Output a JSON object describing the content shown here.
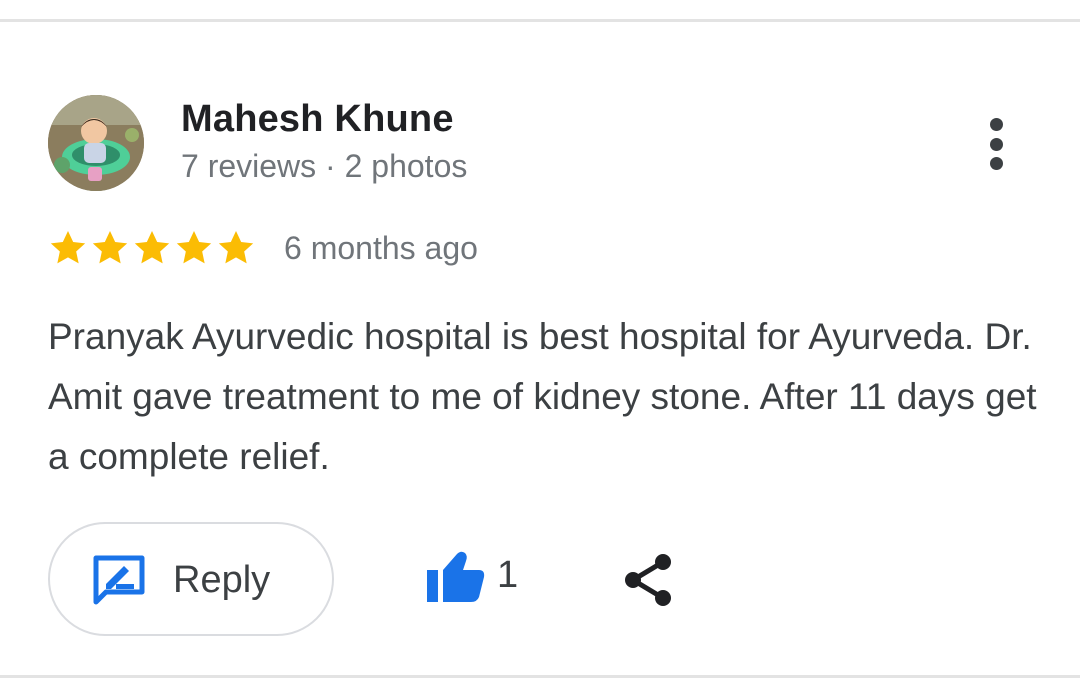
{
  "review": {
    "author": {
      "name": "Mahesh Khune",
      "meta": "7 reviews · 2 photos",
      "avatar_icon": "user-avatar-photo"
    },
    "rating": 5,
    "rating_max": 5,
    "time_ago": "6 months ago",
    "text": "Pranyak Ayurvedic hospital is best hospital for Ayurveda. Dr. Amit gave treatment to me of kidney stone. After 11 days get a complete relief.",
    "more_icon": "more-vert-icon"
  },
  "actions": {
    "reply_label": "Reply",
    "reply_icon": "rate-review-icon",
    "like_icon": "thumb-up-icon",
    "like_count": "1",
    "share_icon": "share-icon"
  },
  "colors": {
    "star": "#fbbc04",
    "accent_blue": "#1a73e8",
    "text_primary": "#202124",
    "text_secondary": "#70757a",
    "text_body": "#3c4043",
    "divider": "#e3e3e3"
  }
}
